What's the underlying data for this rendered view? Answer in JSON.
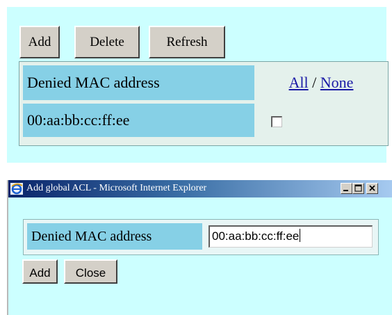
{
  "acl_list": {
    "toolbar": {
      "add_label": "Add",
      "delete_label": "Delete",
      "refresh_label": "Refresh"
    },
    "table": {
      "header": "Denied MAC address",
      "select_all_label": "All",
      "separator": "/",
      "select_none_label": "None",
      "rows": [
        {
          "mac": "00:aa:bb:cc:ff:ee",
          "checked": false
        }
      ]
    }
  },
  "dialog": {
    "title": "Add global ACL - Microsoft Internet Explorer",
    "field_label": "Denied MAC address",
    "field_value": "00:aa:bb:cc:ff:ee",
    "add_label": "Add",
    "close_label": "Close",
    "icons": [
      "ie-icon",
      "minimize-icon",
      "maximize-icon",
      "close-icon"
    ]
  },
  "colors": {
    "panel_background": "#ccffff",
    "label_cell": "#86d0e6",
    "value_cell": "#e4f1ec",
    "link": "#1a1aa6",
    "button_face": "#d4d0c8",
    "titlebar_start": "#0a246a",
    "titlebar_end": "#a6caf0"
  }
}
